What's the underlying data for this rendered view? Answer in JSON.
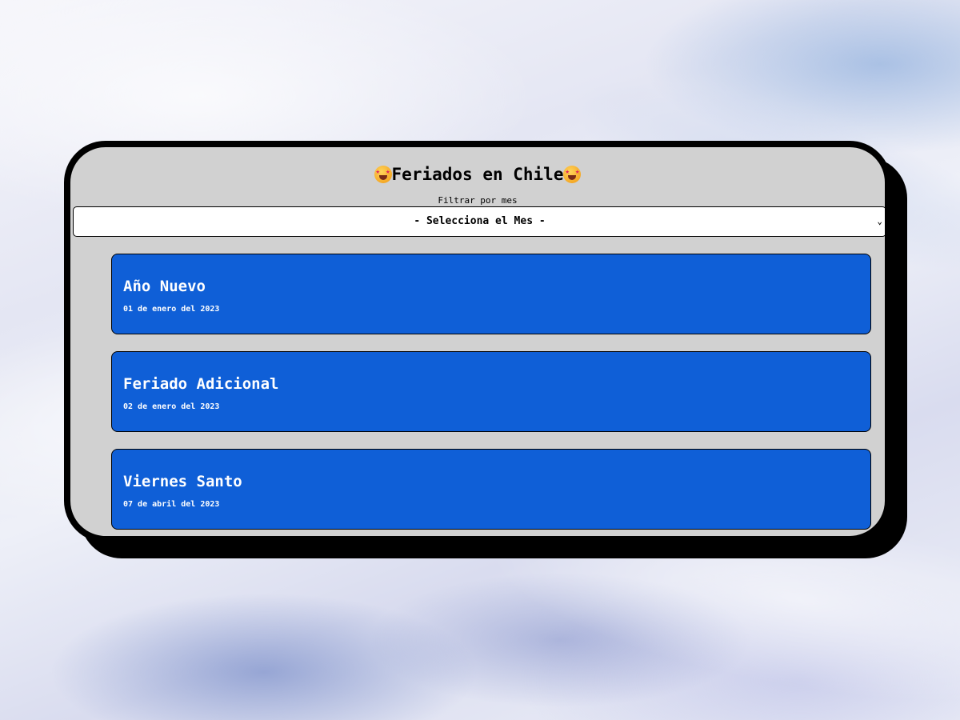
{
  "app": {
    "title": "Feriados en Chile",
    "title_emoji": "star-struck-face",
    "accent_color": "#0f5fd7",
    "panel_color": "#d1d1d1"
  },
  "filter": {
    "label": "Filtrar por mes",
    "selected": "- Selecciona el Mes -"
  },
  "holidays": [
    {
      "name": "Año Nuevo",
      "date": "01 de enero del 2023"
    },
    {
      "name": "Feriado Adicional",
      "date": "02 de enero del 2023"
    },
    {
      "name": "Viernes Santo",
      "date": "07 de abril del 2023"
    }
  ]
}
